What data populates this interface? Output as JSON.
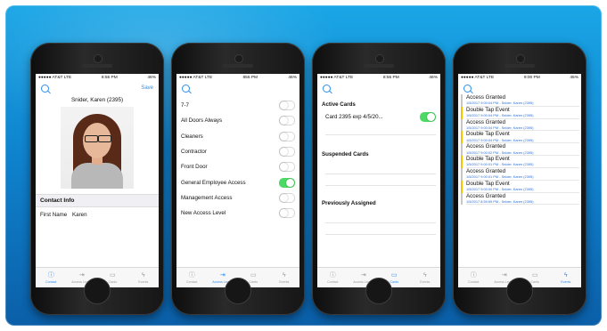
{
  "phones": [
    {
      "status": {
        "carrier": "●●●●● AT&T  LTE",
        "time": "8:55 PM",
        "battery": "46%"
      },
      "nav": {
        "action": "Save"
      },
      "contact": {
        "name": "Snider, Karen (2395)",
        "section": "Contact Info",
        "first_name_label": "First Name",
        "first_name_value": "Karen"
      },
      "tabs": [
        {
          "label": "Contact"
        },
        {
          "label": "Access Levels"
        },
        {
          "label": "Cards"
        },
        {
          "label": "Events"
        }
      ],
      "active_tab": 0
    },
    {
      "status": {
        "carrier": "●●●●● AT&T  LTE",
        "time": "855 PM",
        "battery": "46%"
      },
      "levels": [
        {
          "label": "7-7",
          "on": false
        },
        {
          "label": "All Doors Always",
          "on": false
        },
        {
          "label": "Cleaners",
          "on": false
        },
        {
          "label": "Contractor",
          "on": false
        },
        {
          "label": "Front Door",
          "on": false
        },
        {
          "label": "General Employee Access",
          "on": true
        },
        {
          "label": "Management Access",
          "on": false
        },
        {
          "label": "New Access Level",
          "on": false
        }
      ],
      "tabs": [
        {
          "label": "Contact"
        },
        {
          "label": "Access Levels"
        },
        {
          "label": "Cards"
        },
        {
          "label": "Events"
        }
      ],
      "active_tab": 1
    },
    {
      "status": {
        "carrier": "●●●●● AT&T  LTE",
        "time": "8:55 PM",
        "battery": "46%"
      },
      "cards": {
        "active_title": "Active Cards",
        "active_card": "Card 2395 exp 4/5/20...",
        "active_card_on": true,
        "suspended_title": "Suspended Cards",
        "previous_title": "Previously Assigned"
      },
      "tabs": [
        {
          "label": "Contact"
        },
        {
          "label": "Access Levels"
        },
        {
          "label": "Cards"
        },
        {
          "label": "Events"
        }
      ],
      "active_tab": 2
    },
    {
      "status": {
        "carrier": "●●●●● AT&T  LTE",
        "time": "9:00 PM",
        "battery": "45%"
      },
      "events": [
        {
          "title": "Access Granted",
          "detail": "1/5/2017 9:00:04 PM - Snider, Karen (2395)",
          "marker": "gray"
        },
        {
          "title": "Double Tap Event",
          "detail": "1/5/2017 9:00:04 PM - Snider, Karen (2395)",
          "marker": "yellow"
        },
        {
          "title": "Access Granted",
          "detail": "1/5/2017 9:00:04 PM - Snider, Karen (2395)",
          "marker": "gray"
        },
        {
          "title": "Double Tap Event",
          "detail": "1/5/2017 9:00:04 PM - Snider, Karen (2395)",
          "marker": "yellow"
        },
        {
          "title": "Access Granted",
          "detail": "1/5/2017 9:00:02 PM - Snider, Karen (2395)",
          "marker": "gray"
        },
        {
          "title": "Double Tap Event",
          "detail": "1/5/2017 9:00:01 PM - Snider, Karen (2395)",
          "marker": "yellow"
        },
        {
          "title": "Access Granted",
          "detail": "1/5/2017 9:00:01 PM - Snider, Karen (2395)",
          "marker": "gray"
        },
        {
          "title": "Double Tap Event",
          "detail": "1/5/2017 9:00:00 PM - Snider, Karen (2395)",
          "marker": "yellow"
        },
        {
          "title": "Access Granted",
          "detail": "1/5/2017 8:59:59 PM - Snider, Karen (2395)",
          "marker": "gray"
        }
      ],
      "tabs": [
        {
          "label": "Contact"
        },
        {
          "label": "Access Levels"
        },
        {
          "label": "Cards"
        },
        {
          "label": "Events"
        }
      ],
      "active_tab": 3
    }
  ],
  "icons": {
    "search": "search-icon",
    "tab_contact": "info-circle-icon",
    "tab_access": "door-enter-icon",
    "tab_cards": "id-card-icon",
    "tab_events": "lightning-icon"
  },
  "colors": {
    "accent": "#2d8ef0",
    "toggle_on": "#4cd964",
    "event_marker": "#f5c400",
    "banner": "#0f84cf"
  }
}
